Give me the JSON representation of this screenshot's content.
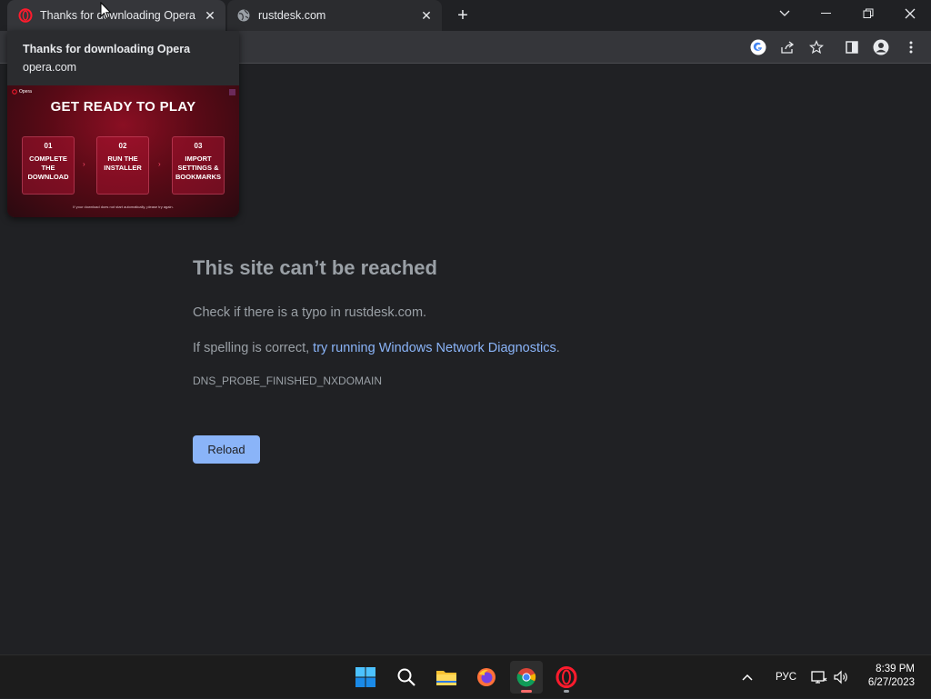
{
  "tabs": [
    {
      "title": "Thanks for downloading Opera",
      "favicon": "opera-icon",
      "active": true
    },
    {
      "title": "rustdesk.com",
      "favicon": "globe-icon",
      "active": false
    }
  ],
  "hovercard": {
    "title": "Thanks for downloading Opera",
    "url": "opera.com",
    "preview": {
      "logo": "Opera",
      "heading": "GET READY TO PLAY",
      "steps": [
        {
          "num": "01",
          "lines": [
            "COMPLETE",
            "THE",
            "DOWNLOAD"
          ]
        },
        {
          "num": "02",
          "lines": [
            "RUN THE",
            "INSTALLER"
          ]
        },
        {
          "num": "03",
          "lines": [
            "IMPORT",
            "SETTINGS &",
            "BOOKMARKS"
          ]
        }
      ],
      "footer": "If your download does not start automatically, please try again."
    }
  },
  "error": {
    "title": "This site can’t be reached",
    "line1": "Check if there is a typo in rustdesk.com.",
    "line2_prefix": "If spelling is correct, ",
    "line2_link": "try running Windows Network Diagnostics",
    "line2_suffix": ".",
    "code": "DNS_PROBE_FINISHED_NXDOMAIN",
    "reload_label": "Reload"
  },
  "tray": {
    "language": "РУС",
    "time": "8:39 PM",
    "date": "6/27/2023"
  },
  "colors": {
    "background": "#202124",
    "link": "#8ab4f8",
    "button": "#8ab4f8",
    "opera_red": "#ff1b2d"
  }
}
